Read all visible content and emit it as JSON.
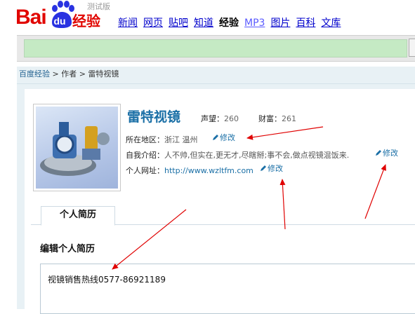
{
  "header": {
    "logo_bai": "Bai",
    "logo_du": "du",
    "logo_jingyan": "经验",
    "logo_beta": "测试版",
    "nav": [
      {
        "label": "新闻",
        "current": false
      },
      {
        "label": "网页",
        "current": false
      },
      {
        "label": "贴吧",
        "current": false
      },
      {
        "label": "知道",
        "current": false
      },
      {
        "label": "经验",
        "current": true
      },
      {
        "label": "MP3",
        "current": false
      },
      {
        "label": "图片",
        "current": false
      },
      {
        "label": "百科",
        "current": false
      },
      {
        "label": "文库",
        "current": false
      }
    ]
  },
  "search": {
    "value": ""
  },
  "breadcrumb": {
    "home": "百度经验",
    "sep1": " > ",
    "author": "作者",
    "sep2": " > ",
    "current": "雷特视镜"
  },
  "profile": {
    "name": "雷特视镜",
    "reputation_label": "声望：",
    "reputation_value": "260",
    "wealth_label": "财富：",
    "wealth_value": "261",
    "region_label": "所在地区：",
    "region_value": "浙江 温州",
    "intro_label": "自我介绍：",
    "intro_value": "人不帅,但实在,更无才,尽瞎掰;事不会,做点视镜混饭来.",
    "site_label": "个人网址：",
    "site_value": "http://www.wzltfm.com",
    "edit_label": "修改"
  },
  "tabs": [
    {
      "label": "个人简历",
      "active": true
    }
  ],
  "resume": {
    "title": "编辑个人简历",
    "content": "视镜销售热线0577-86921189"
  },
  "colors": {
    "brand_red": "#e10601",
    "brand_blue": "#2932e1",
    "link_blue": "#1a6fa6",
    "annotation_red": "#e00000"
  }
}
